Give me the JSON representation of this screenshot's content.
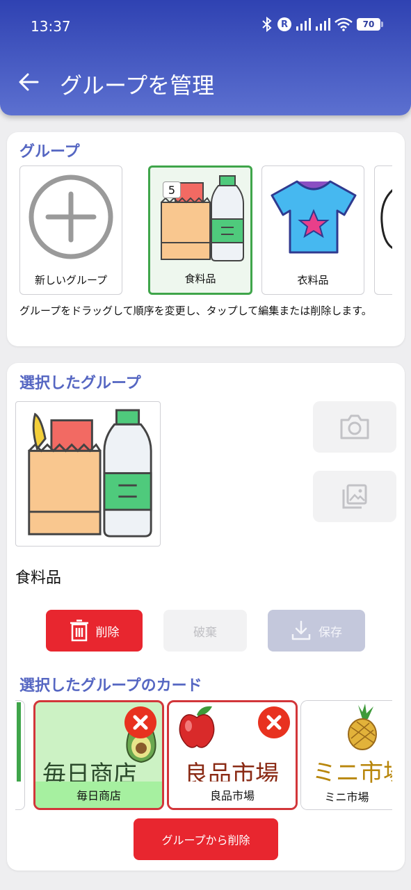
{
  "status": {
    "time": "13:37",
    "roaming": "R",
    "battery": "70"
  },
  "header": {
    "title": "グループを管理"
  },
  "groups": {
    "title": "グループ",
    "items": [
      {
        "label": "新しいグループ"
      },
      {
        "label": "食料品",
        "count": "5",
        "selected": true
      },
      {
        "label": "衣料品"
      }
    ],
    "help": "グループをドラッグして順序を変更し、タップして編集または削除します。"
  },
  "selected_group": {
    "title": "選択したグループ",
    "name": "食料品",
    "delete_label": "削除",
    "discard_label": "破棄",
    "save_label": "保存"
  },
  "group_cards": {
    "title": "選択したグループのカード",
    "items": [
      {
        "big_text": "毎日商店",
        "caption": "毎日商店"
      },
      {
        "big_text": "良品市場",
        "caption": "良品市場"
      },
      {
        "big_text": "ミニ市場",
        "caption": "ミニ市場"
      }
    ],
    "remove_label": "グループから削除"
  },
  "colors": {
    "accent": "#3a4cb8",
    "danger": "#e8262f",
    "selected": "#3fa54a",
    "section": "#5566c2"
  }
}
